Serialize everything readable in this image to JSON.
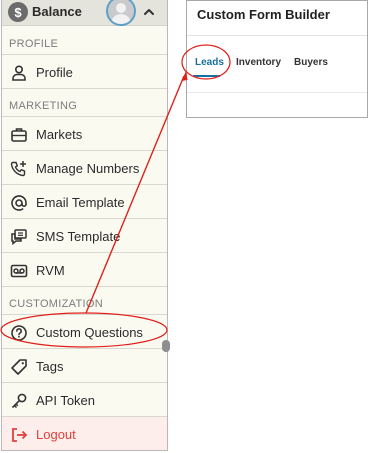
{
  "menu": {
    "balance_symbol": "$",
    "balance_label": "Balance",
    "sections": {
      "profile": "PROFILE",
      "marketing": "MARKETING",
      "customization": "CUSTOMIZATION"
    },
    "items": {
      "profile": "Profile",
      "markets": "Markets",
      "manage_numbers": "Manage Numbers",
      "email_template": "Email Template",
      "sms_template": "SMS Template",
      "rvm": "RVM",
      "custom_questions": "Custom Questions",
      "tags": "Tags",
      "api_token": "API Token",
      "logout": "Logout"
    }
  },
  "builder": {
    "title": "Custom Form Builder",
    "tabs": [
      "Leads",
      "Inventory",
      "Buyers"
    ],
    "active_tab": "Leads"
  },
  "colors": {
    "annotation_red": "#e0201b",
    "active_tab_blue": "#1a6fa2",
    "logout_red": "#e0413b",
    "menu_bg": "#fbfaf1"
  },
  "icons": [
    "dollar-icon",
    "avatar-icon",
    "chevron-up-icon",
    "user-icon",
    "briefcase-icon",
    "phone-plus-icon",
    "at-icon",
    "chat-icon",
    "voicemail-icon",
    "question-circle-icon",
    "tag-icon",
    "key-icon",
    "logout-icon"
  ]
}
